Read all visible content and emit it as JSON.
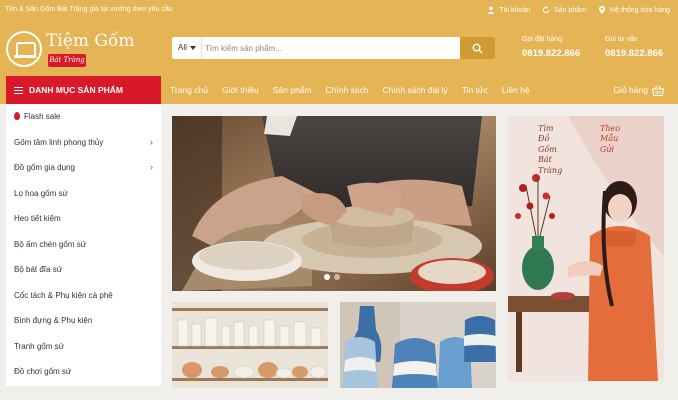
{
  "topbar": {
    "tagline": "Tìm & Sản Gốm Bát Tràng giá tại xưởng theo yêu cầu",
    "links": [
      {
        "label": "Tài khoản",
        "icon": "user-icon"
      },
      {
        "label": "Sản phẩm",
        "icon": "refresh-icon"
      },
      {
        "label": "Hệ thống cửa hàng",
        "icon": "location-pin-icon"
      }
    ]
  },
  "logo": {
    "name": "Tiệm Gốm",
    "sub": "Bát Tràng"
  },
  "search": {
    "category": "All",
    "placeholder": "Tìm kiếm sản phẩm...",
    "icon": "search-icon"
  },
  "hotlines": [
    {
      "label": "Gọi đặt hàng",
      "number": "0819.822.866"
    },
    {
      "label": "Gọi tư vấn",
      "number": "0819.822.866"
    }
  ],
  "nav": {
    "category_button": "DANH MỤC SẢN PHẨM",
    "menu": [
      "Trang chủ",
      "Giới thiệu",
      "Sản phẩm",
      "Chính sách",
      "Chính sách đại lý",
      "Tin tức",
      "Liên hệ"
    ],
    "cart": "Giỏ hàng"
  },
  "categories": [
    {
      "label": "Flash sale",
      "flash": true
    },
    {
      "label": "Gốm tâm linh phong thủy",
      "has_sub": true
    },
    {
      "label": "Đồ gốm gia dụng",
      "has_sub": true
    },
    {
      "label": "Lọ hoa gốm sứ"
    },
    {
      "label": "Heo tiết kiệm"
    },
    {
      "label": "Bộ ấm chén gốm sứ"
    },
    {
      "label": "Bộ bát đĩa sứ"
    },
    {
      "label": "Cốc tách & Phụ kiện cà phê"
    },
    {
      "label": "Bình đựng & Phụ kiện"
    },
    {
      "label": "Tranh gốm sứ"
    },
    {
      "label": "Đồ chơi gốm sứ"
    }
  ],
  "side_banner": {
    "left_column": [
      "Tìm",
      "Đồ",
      "Gốm",
      "Bát",
      "Tràng"
    ],
    "right_column": [
      "Theo",
      "Mẫu",
      "Gửi"
    ]
  },
  "slider": {
    "dots": 2,
    "active": 0
  },
  "colors": {
    "brand": "#e5b455",
    "accent_red": "#d7192a",
    "search_button": "#d29a33"
  }
}
